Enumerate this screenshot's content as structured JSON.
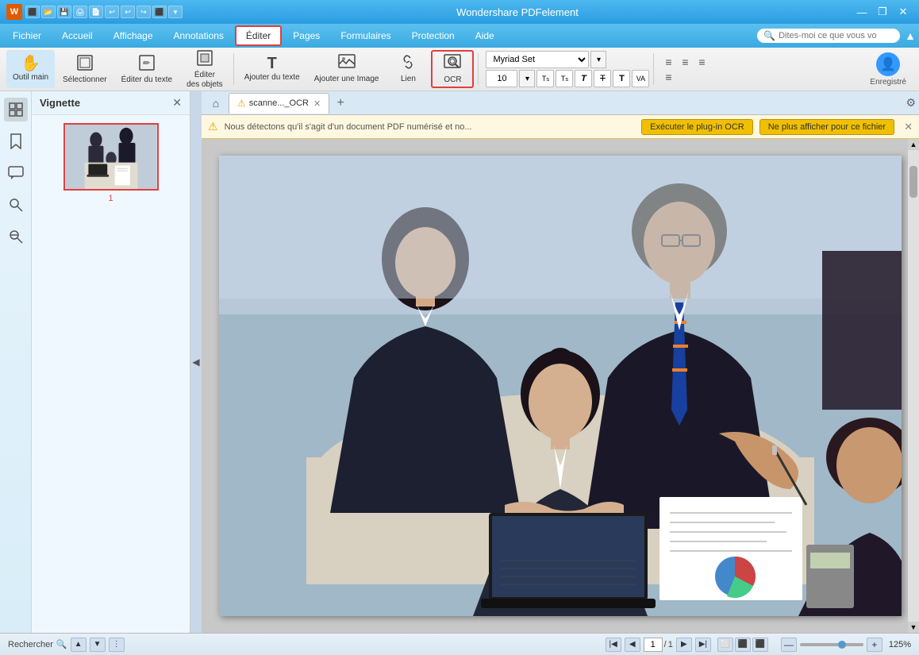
{
  "app": {
    "title": "Wondershare PDFelement",
    "minimize": "—",
    "restore": "❐",
    "close": "✕"
  },
  "titlebar": {
    "icon_label": "W",
    "quick_tools": [
      "⬛",
      "⬛",
      "⬛",
      "⬛",
      "⬛",
      "⬛",
      "⬛",
      "⬛",
      "⬛",
      "⬛",
      "⬛"
    ]
  },
  "menubar": {
    "items": [
      "Fichier",
      "Accueil",
      "Affichage",
      "Annotations",
      "Éditer",
      "Pages",
      "Formulaires",
      "Protection",
      "Aide"
    ],
    "active_item": "Éditer",
    "search_placeholder": "Dites-moi ce que vous vo"
  },
  "toolbar": {
    "tools": [
      {
        "id": "outil-main",
        "label": "Outil main",
        "icon": "✋"
      },
      {
        "id": "selectionner",
        "label": "Sélectionner",
        "icon": "⬜"
      },
      {
        "id": "editer-texte",
        "label": "Éditer du texte",
        "icon": "✏"
      },
      {
        "id": "editer-objets",
        "label": "Éditer des objets",
        "icon": "🔲"
      },
      {
        "id": "ajouter-texte",
        "label": "Ajouter du texte",
        "icon": "T"
      },
      {
        "id": "ajouter-image",
        "label": "Ajouter une Image",
        "icon": "🖼"
      },
      {
        "id": "lien",
        "label": "Lien",
        "icon": "🔗"
      },
      {
        "id": "ocr",
        "label": "OCR",
        "icon": "🔍"
      }
    ],
    "font": {
      "name": "Myriad Set",
      "size": "10"
    },
    "enregistre_label": "Enregistré"
  },
  "sidebar": {
    "icons": [
      "☞",
      "🔖",
      "💬",
      "🔍",
      "🔎"
    ]
  },
  "thumbnail_panel": {
    "title": "Vignette",
    "close_icon": "✕",
    "page_number": "1"
  },
  "tabs": {
    "home_icon": "⌂",
    "items": [
      {
        "label": "scanne..._OCR",
        "icon": "⚠",
        "active": true
      }
    ],
    "add_icon": "+",
    "settings_icon": "⚙"
  },
  "ocr_bar": {
    "warning_icon": "⚠",
    "text": "Nous détectons qu'il s'agit d'un document PDF numérisé et no...",
    "execute_btn": "Exécuter le plug-in OCR",
    "dismiss_btn": "Ne plus afficher pour ce fichier",
    "close_icon": "✕"
  },
  "statusbar": {
    "search_label": "Rechercher",
    "search_icon": "🔍",
    "nav_first": "|◀",
    "nav_prev": "◀",
    "nav_next": "▶",
    "nav_last": "▶|",
    "current_page": "1",
    "total_pages": "1",
    "view_icons": [
      "⬜",
      "⬛",
      "⬛"
    ],
    "zoom_minus": "—",
    "zoom_plus": "+",
    "zoom_level": "125%"
  }
}
